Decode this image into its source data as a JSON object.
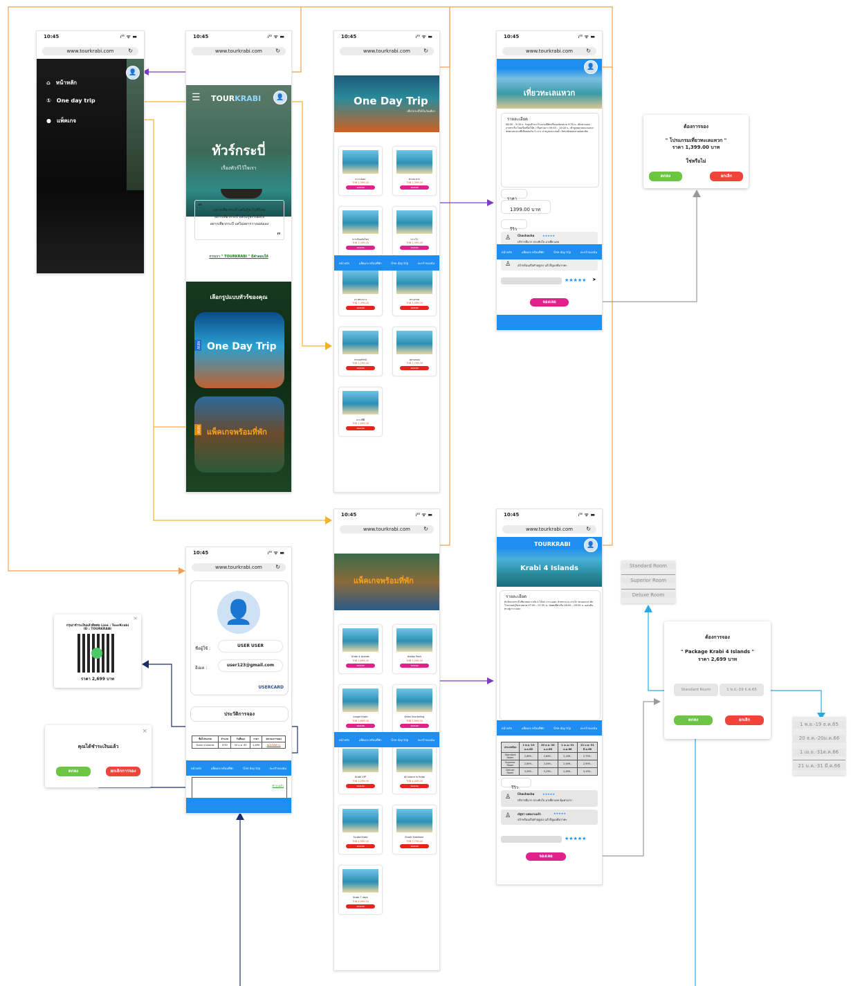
{
  "status_time": "10:45",
  "status_icons": "ᵢᶦᶦ ᯤ ▬",
  "url": "www.tourkrabi.com",
  "brand": {
    "tour": "TOUR",
    "krabi": "KRABI"
  },
  "drawer": {
    "items": [
      {
        "icon": "home-icon",
        "label": "หน้าหลัก"
      },
      {
        "icon": "day-trip-icon",
        "label": "One day trip"
      },
      {
        "icon": "package-icon",
        "label": "แพ็คเกจ"
      }
    ]
  },
  "home": {
    "hero_title": "ทัวร์กระบี่",
    "hero_subtitle": "เรื่องทัวร์ไว้ใจเรา",
    "quote_lines": [
      "อยากเที่ยวกระบี่ แต่ไม่รู้จะไปที่ไหน",
      "อยากเที่ยวกระบี่ แต่ไม่รู้จะไปยังไง",
      "อยากเที่ยวกระบี่ แต่ไม่อยากวางแผนเอง"
    ],
    "tagline": "การเรา \" TOURKRABI \" มีคำตอบให้",
    "choose_title": "เลือกรูปแบบทัวร์ของคุณ",
    "banner_day": "One Day Trip",
    "banner_pkg": "แพ็คเกจพร้อมที่พัก",
    "banner_new": "NEW"
  },
  "day_trip": {
    "banner": "One Day Trip",
    "sub": "เที่ยวกระบี่ได้ในวันเดียว",
    "cards": [
      {
        "name": "เกาะปอดะ",
        "price": "THB 1,399.00",
        "btn": "จองเลย"
      },
      {
        "name": "ทะเลแหวก",
        "price": "THB 1,399.00",
        "btn": "จองเลย"
      },
      {
        "name": "เกาะห้องคันไทร",
        "price": "THB 1,399.00",
        "btn": "จองเลย"
      },
      {
        "name": "เกาะไก่",
        "price": "THB 1,399.00",
        "btn": "จองเลย"
      },
      {
        "name": "อ่าวพระนาง",
        "price": "THB 1,399.00",
        "btn": "จองเลย"
      },
      {
        "name": "สระมรกต",
        "price": "THB 1,399.00",
        "btn": "จองเลย"
      },
      {
        "name": "หาดนพรัตน์",
        "price": "THB 1,299.00",
        "btn": "จองเลย"
      },
      {
        "name": "สุสานหอย",
        "price": "THB 1,799.00",
        "btn": "จองเลย"
      },
      {
        "name": "เกาะพีพี",
        "price": "THB 1,899.00",
        "btn": "จองเลย"
      }
    ]
  },
  "packages": {
    "banner": "แพ็คเกจพร้อมที่พัก",
    "cards": [
      {
        "name": "Krabi 4 Islands",
        "price": "THB 2,699.00",
        "btn": "จองเลย"
      },
      {
        "name": "Hobby Pack",
        "price": "THB 2,099.00",
        "btn": "จองเลย"
      },
      {
        "name": "Jungle Krabi",
        "price": "THB 2,899.00",
        "btn": "จองเลย"
      },
      {
        "name": "Krabi Snorkeling",
        "price": "THB 2,999.00",
        "btn": "จองเลย"
      },
      {
        "name": "Krabi VIP",
        "price": "THB 3,299.00",
        "btn": "จองเลย"
      },
      {
        "name": "All Island in Krabi",
        "price": "THB 4,499.00",
        "btn": "จองเลย"
      },
      {
        "name": "Scuba Krabi",
        "price": "THB 4,999.00",
        "btn": "จองเลย"
      },
      {
        "name": "Shark Krabitour",
        "price": "THB 2,799.00",
        "btn": "จองเลย"
      },
      {
        "name": "Krabi 7 days",
        "price": "THB 6,999.00",
        "btn": "จองเลย"
      }
    ]
  },
  "nav": [
    "หน้าหลัก",
    "แพ็คเกจ พร้อมที่พัก",
    "One day trip",
    "ตะกร้าของฉัน"
  ],
  "detail_day": {
    "hero_title": "เที่ยวทะเลแหวก",
    "section_detail": "รายละเอียด",
    "detail_text": "08:00 – 9:00 น. รับลูกค้าจากโรงแรมที่พักหรือจุดนัดหมาย 9:30 น. เดินทางออกจากท่าเรือ โดยเรือสปีดโบ๊ท / เรือหางยาว 09:40 – 10:00 น. เข้าสู่อุทยานทะเลแหวก ชมทะเลแหวกที่เชื่อมต่อกัน 3 เกาะ ถ่ายรูปและเล่นน้ำ อิสระพักผ่อนตามอัธยาศัย",
    "price_label": "ราคา",
    "price_value": "1399.00 บาท",
    "review_label": "รีวิว",
    "reviews": [
      {
        "name": "Chachacha",
        "stars": "★★★★★",
        "text": "บริการดีมาก ประทับใจ มาเที่ยวเลย"
      },
      {
        "name": "ณัฐชา แพลงามแล้ว",
        "stars": "★★★★★",
        "text": "สถ้าพร้อมเรือทำอยู่เก่ง แล้วก็ดูแลดีมากค่ะ"
      }
    ],
    "stars_input": "★★★★★",
    "send": "➤",
    "book_btn": "จองเลย"
  },
  "detail_pkg": {
    "hero_title": "Krabi 4 Islands",
    "section_detail": "รายละเอียด",
    "detail_text": "ทัวร์ทะเลกระบี่ เที่ยวชมเกาะทั้ง 4 ได้แก่ เกาะปอดะ ถ้ำพระนาง เกาะไก่ ทะเลแหวก พักโรงแรมหรูริมชายหาด 07:00 – 07:30 น. นัดพบที่ท่าเรือ 08:00 – 09:30 น. ออกเดินทางสู่เกาะปอดะ",
    "table_headers": [
      "ประเภทห้อง",
      "1 พ.ย.-19 ธ.ค.65",
      "20 ธ.ค.-20 ม.ค.66",
      "1 เม.ย.-31 ต.ค.66",
      "21 ม.ค.-31 มี.ค.66"
    ],
    "table_rows": [
      [
        "Standard Room",
        "2,699.-",
        "2,899.-",
        "2,499.-",
        "2,799.-"
      ],
      [
        "Superior Room",
        "2,899.-",
        "3,099.-",
        "2,699.-",
        "2,999.-"
      ],
      [
        "Deluxe Room",
        "3,099.-",
        "3,299.-",
        "2,899.-",
        "3,199.-"
      ]
    ],
    "review_label": "รีวิว",
    "reviews": [
      {
        "name": "Chachacha",
        "stars": "★★★★★",
        "text": "บริการดีมาก ประทับใจ มาเที่ยวเลย คุ้มค่ามาก"
      },
      {
        "name": "ณัฐชา แพลงามแล้ว",
        "stars": "★★★★★",
        "text": "สถ้าพร้อมเรือทำอยู่เก่ง แล้วก็ดูแลดีมากค่ะ"
      }
    ],
    "stars_input": "★★★★★",
    "book_btn": "จองเลย"
  },
  "confirm_day": {
    "title": "ต้องการจอง",
    "program": "\" โปรแกรมเที่ยวทะเลแหวก \"",
    "price": "ราคา 1,399.00 บาท",
    "question": "ใช่หรือไม่",
    "ok": "ตกลง",
    "cancel": "ยกเลิก"
  },
  "confirm_pkg": {
    "title": "ต้องการจอง",
    "program": "\" Package Krabi 4 Islands \"",
    "price": "ราคา 2,699 บาท",
    "room_select": "Standard Room",
    "date_select": "1 พ.ย.-19 ธ.ค.65",
    "ok": "ตกลง",
    "cancel": "ยกเลิก"
  },
  "room_options": [
    "Standard Room",
    "Superior Room",
    "Deluxe Room"
  ],
  "date_options": [
    "1 พ.ย.-19 ธ.ค.65",
    "20 ธ.ค.-20ม.ค.66",
    "1 เม.ย.-31ต.ค.66",
    "21 ม.ค.-31 มี.ค.66"
  ],
  "user": {
    "name_label": "ชื่อผู้ใช้ :",
    "name_value": "USER USER",
    "email_label": "อีเมล :",
    "email_value": "user123@gmail.com",
    "card_label": "USERCARD",
    "history_title": "ประวัติการจอง",
    "history_headers": [
      "ชื่อโปรแกรม",
      "จำนวน",
      "วันที่จอง",
      "ราคา",
      "สถานะการจอง"
    ],
    "history_row": [
      "Krabi 4 Islands",
      "SITD",
      "20 ธ.ค. 65",
      "2,899",
      "ยังไม่ได้ชำระ"
    ],
    "history_status2": "ชำระแล้ว"
  },
  "qr_dialog": {
    "line1": "กรุณาชำระเงินแล้วติดต่อ Line : TourKrabi",
    "line2": "ID : TOURKRABI",
    "amount": "ราคา 2,699 บาท",
    "close": "×"
  },
  "paid_dialog": {
    "title": "คุณได้ชำระเงินแล้ว",
    "ok": "ตกลง",
    "cancel": "ยกเลิกการจอง",
    "close": "×"
  },
  "colors": {
    "blue": "#1e8ff0",
    "orange": "#f0a050",
    "purple": "#7b3fc4",
    "gold": "#f5b02e",
    "navy": "#1c2f6b",
    "cyan": "#2aa9e0",
    "gray": "#9a9a9a"
  }
}
